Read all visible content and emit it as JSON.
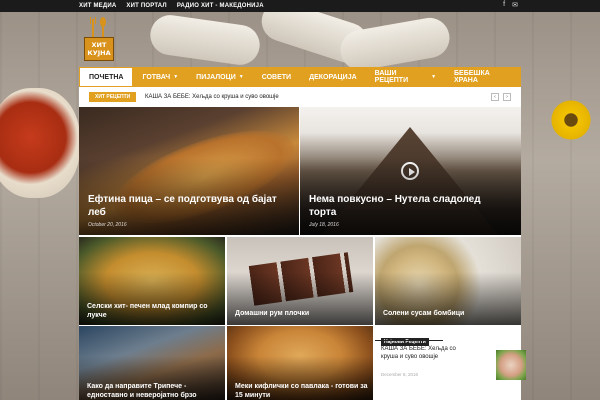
{
  "topbar": {
    "links": [
      "ХИТ МЕДИА",
      "ХИТ ПОРТАЛ",
      "РАДИО ХИТ - МАКЕДОНИЈА"
    ],
    "social": [
      "facebook-icon",
      "mail-icon"
    ]
  },
  "logo": {
    "line1": "ХИТ",
    "line2": "КУЈНА"
  },
  "nav": {
    "items": [
      {
        "label": "ПОЧЕТНА",
        "active": true,
        "dropdown": false
      },
      {
        "label": "ГОТВАЧ",
        "active": false,
        "dropdown": true
      },
      {
        "label": "ПИЈАЛОЦИ",
        "active": false,
        "dropdown": true
      },
      {
        "label": "СОВЕТИ",
        "active": false,
        "dropdown": false
      },
      {
        "label": "ДЕКОРАЦИЈА",
        "active": false,
        "dropdown": false
      },
      {
        "label": "ВАШИ РЕЦЕПТИ",
        "active": false,
        "dropdown": true
      },
      {
        "label": "БЕБЕШКА ХРАНА",
        "active": false,
        "dropdown": false
      }
    ],
    "accent": "#e1a01f"
  },
  "ticker": {
    "label": "ХИТ РЕЦЕПТИ",
    "text": "КАША ЗА БЕБЕ: Хељда со круша и суво овошје"
  },
  "featured": [
    {
      "title": "Ефтина пица – се подготвува од бајат леб",
      "date": "October 20, 2016"
    },
    {
      "title": "Нема повкусно – Нутела сладолед торта",
      "date": "July 18, 2016"
    }
  ],
  "grid": [
    {
      "title": "Селски хит- печен млад компир со лукче"
    },
    {
      "title": "Домашни рум плочки"
    },
    {
      "title": "Солени сусам бомбици"
    },
    {
      "title": "Како да направите Трипече - едноставно и неверојатно брзо"
    },
    {
      "title": "Меки кифлички со павлака - готови за 15 минути"
    }
  ],
  "recent": {
    "header": "Најнови Рецепти",
    "title": "КАША ЗА БЕБЕ: Хељда со круша и суво овошје",
    "date": "December 8, 2016"
  }
}
